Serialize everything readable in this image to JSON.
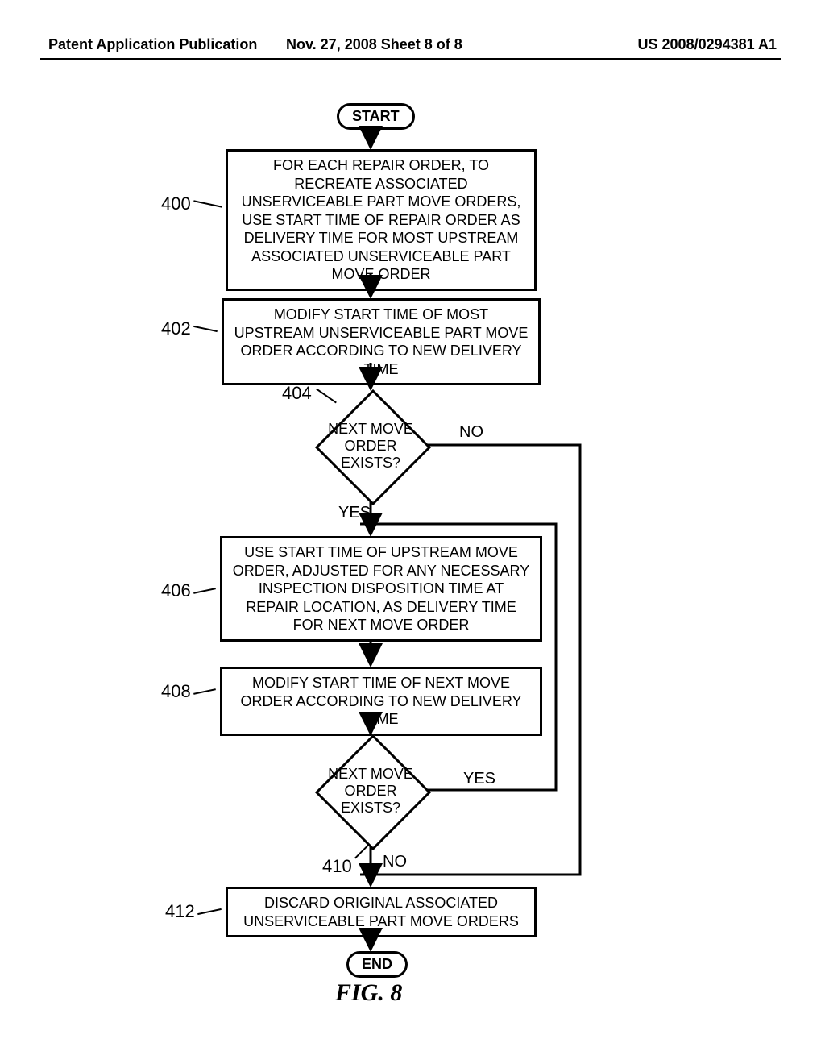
{
  "header": {
    "left": "Patent Application Publication",
    "mid": "Nov. 27, 2008  Sheet 8 of 8",
    "right": "US 2008/0294381 A1"
  },
  "figure_caption": "FIG. 8",
  "nodes": {
    "start": "START",
    "end": "END",
    "p400": "FOR EACH REPAIR ORDER, TO RECREATE ASSOCIATED UNSERVICEABLE PART MOVE ORDERS, USE START TIME OF REPAIR ORDER AS DELIVERY TIME FOR MOST UPSTREAM ASSOCIATED UNSERVICEABLE PART MOVE ORDER",
    "p402": "MODIFY START TIME OF MOST UPSTREAM UNSERVICEABLE PART MOVE ORDER ACCORDING TO NEW DELIVERY TIME",
    "d404": "NEXT MOVE ORDER EXISTS?",
    "p406": "USE START TIME OF UPSTREAM MOVE ORDER, ADJUSTED FOR ANY NECESSARY INSPECTION DISPOSITION TIME AT REPAIR LOCATION, AS DELIVERY TIME FOR NEXT MOVE ORDER",
    "p408": "MODIFY START TIME OF NEXT MOVE ORDER ACCORDING TO NEW DELIVERY TIME",
    "d410": "NEXT MOVE ORDER EXISTS?",
    "p412": "DISCARD ORIGINAL ASSOCIATED UNSERVICEABLE PART MOVE ORDERS"
  },
  "refs": {
    "r400": "400",
    "r402": "402",
    "r404": "404",
    "r406": "406",
    "r408": "408",
    "r410": "410",
    "r412": "412"
  },
  "labels": {
    "yes": "YES",
    "no": "NO"
  }
}
